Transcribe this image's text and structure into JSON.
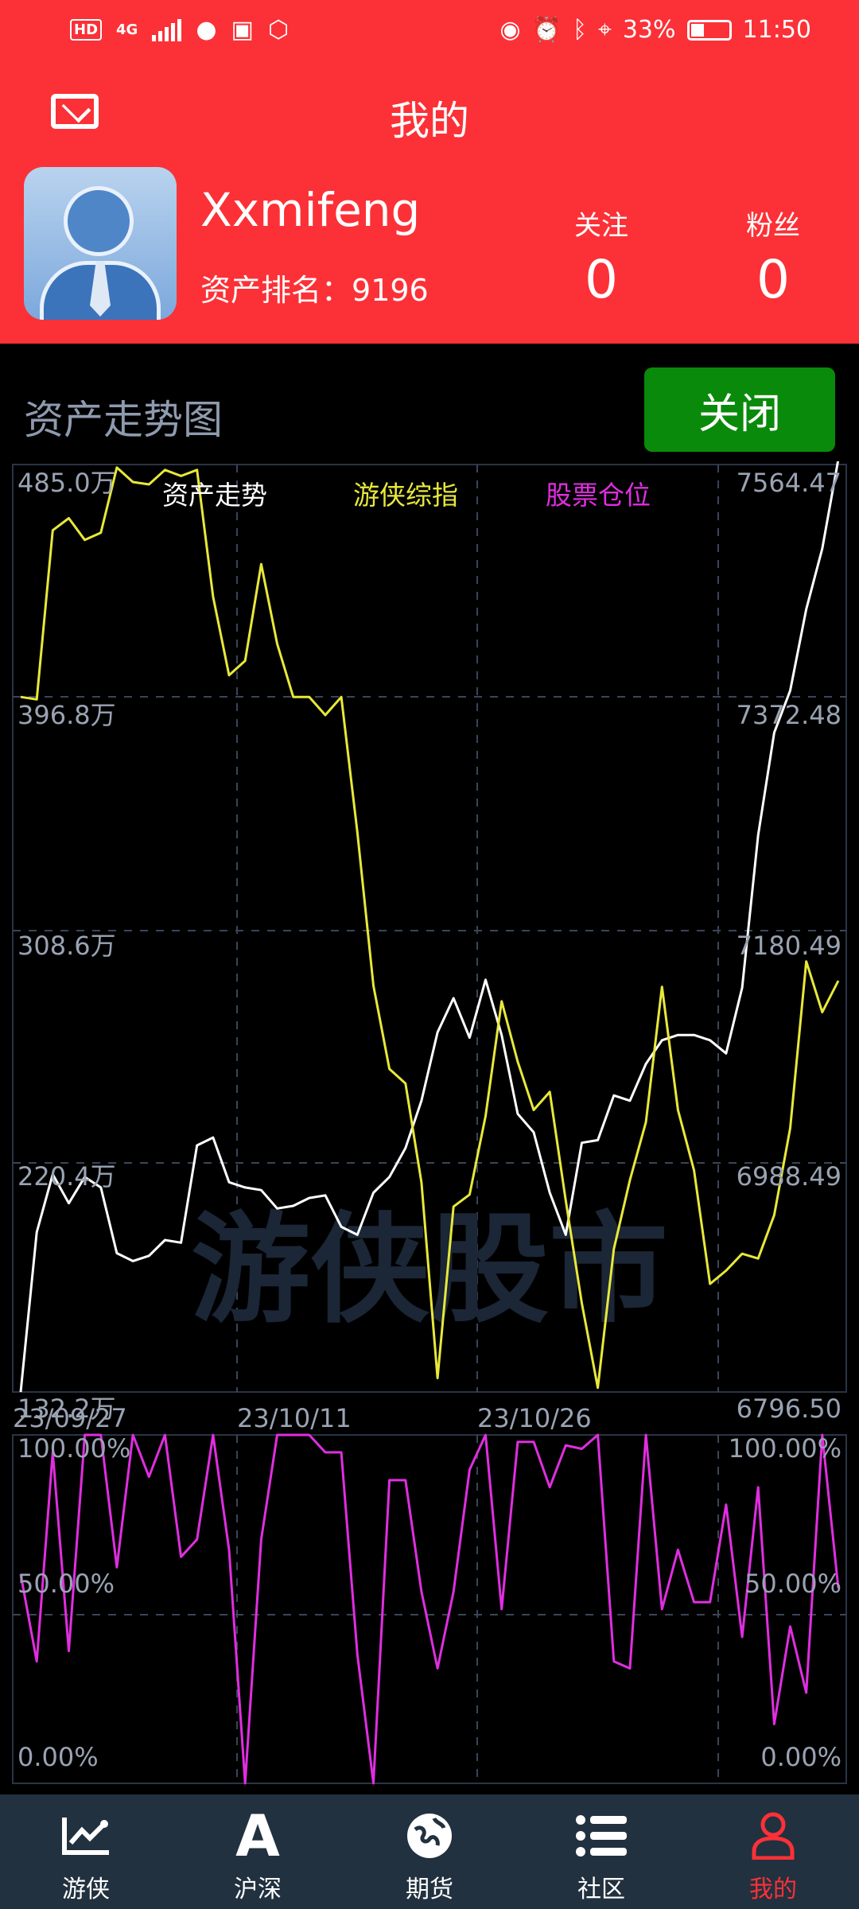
{
  "status_bar": {
    "network": "4G",
    "battery": "33%",
    "time": "11:50"
  },
  "header": {
    "title": "我的",
    "mail_icon": "mail-icon"
  },
  "profile": {
    "username": "Xxmifeng",
    "rank_label": "资产排名：",
    "rank_value": "9196",
    "following_label": "关注",
    "following_count": "0",
    "followers_label": "粉丝",
    "followers_count": "0"
  },
  "section": {
    "title": "资产走势图",
    "close_label": "关闭"
  },
  "watermark": "游侠股市",
  "chart_data": [
    {
      "type": "line",
      "legend": [
        "资产走势",
        "游侠综指",
        "股票仓位"
      ],
      "left_axis_ticks": [
        "485.0万",
        "396.8万",
        "308.6万",
        "220.4万",
        "132.2万"
      ],
      "right_axis_ticks": [
        "7564.47",
        "7372.48",
        "7180.49",
        "6988.49",
        "6796.50"
      ],
      "x_ticks": [
        "23/09/27",
        "23/10/11",
        "23/10/26"
      ],
      "ylim_left": [
        132.2,
        485.0
      ],
      "ylim_right": [
        6796.5,
        7564.47
      ],
      "series": [
        {
          "name": "资产走势",
          "axis": "left",
          "color": "#ffffff",
          "values": [
            132.2,
            193,
            215,
            204,
            214,
            210,
            185,
            182,
            184,
            190,
            189,
            226,
            229,
            212,
            210,
            209,
            202,
            203,
            206,
            207,
            195,
            192,
            208,
            214,
            225,
            243,
            269,
            282,
            267,
            289,
            268,
            238,
            231,
            208,
            192,
            227,
            228,
            245,
            243,
            257,
            266,
            268,
            268,
            266,
            261,
            286,
            344,
            383,
            399,
            430,
            453,
            487
          ]
        },
        {
          "name": "游侠综指",
          "axis": "right",
          "color": "#e8e83a",
          "values": [
            7372,
            7370,
            7510,
            7520,
            7502,
            7508,
            7562,
            7550,
            7548,
            7560,
            7555,
            7560,
            7455,
            7390,
            7402,
            7482,
            7416,
            7372,
            7372,
            7357,
            7372,
            7260,
            7133,
            7064,
            7052,
            6970,
            6808,
            6950,
            6960,
            7025,
            7120,
            7070,
            7030,
            7045,
            6955,
            6870,
            6800,
            6915,
            6972,
            7020,
            7132,
            7030,
            6980,
            6886,
            6897,
            6911,
            6907,
            6943,
            7015,
            7153,
            7111,
            7137
          ]
        },
        {
          "name": "股票仓位",
          "axis": "bottom",
          "color": "#e02ee0",
          "ylim": [
            0,
            100
          ],
          "y_ticks": [
            "100.00%",
            "50.00%",
            "0.00%"
          ],
          "values": [
            60,
            35,
            95,
            38,
            100,
            100,
            62,
            100,
            88,
            100,
            65,
            70,
            100,
            67,
            0,
            70,
            100,
            100,
            100,
            95,
            95,
            37,
            0,
            87,
            87,
            55,
            33,
            55,
            90,
            100,
            50,
            98,
            98,
            85,
            97,
            96,
            100,
            35,
            33,
            100,
            50,
            67,
            52,
            52,
            80,
            42,
            85,
            17,
            45,
            26,
            100,
            56
          ]
        }
      ]
    }
  ],
  "bottom_nav": [
    {
      "label": "游侠",
      "icon": "chart-trend-icon"
    },
    {
      "label": "沪深",
      "icon": "letter-a-icon"
    },
    {
      "label": "期货",
      "icon": "globe-icon"
    },
    {
      "label": "社区",
      "icon": "list-icon"
    },
    {
      "label": "我的",
      "icon": "user-icon",
      "active": true
    }
  ]
}
